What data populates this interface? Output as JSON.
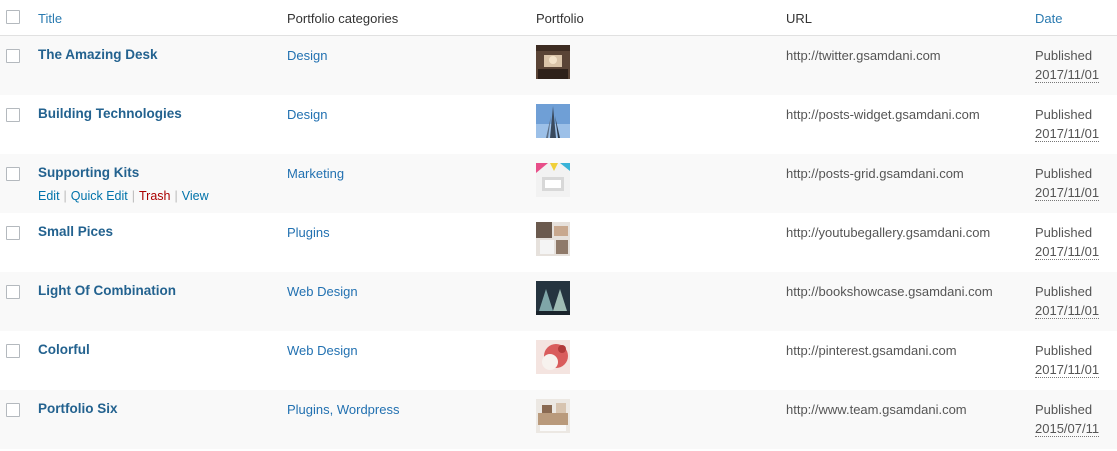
{
  "headers": {
    "title": "Title",
    "categories": "Portfolio categories",
    "portfolio": "Portfolio",
    "url": "URL",
    "date": "Date"
  },
  "row_actions": {
    "edit": "Edit",
    "quick_edit": "Quick Edit",
    "trash": "Trash",
    "view": "View",
    "separator": "|"
  },
  "rows": [
    {
      "title": "The Amazing Desk",
      "categories": "Design",
      "url": "http://twitter.gsamdani.com",
      "status": "Published",
      "date": "2017/11/01"
    },
    {
      "title": "Building Technologies",
      "categories": "Design",
      "url": "http://posts-widget.gsamdani.com",
      "status": "Published",
      "date": "2017/11/01"
    },
    {
      "title": "Supporting Kits",
      "categories": "Marketing",
      "url": "http://posts-grid.gsamdani.com",
      "status": "Published",
      "date": "2017/11/01"
    },
    {
      "title": "Small Pices",
      "categories": "Plugins",
      "url": "http://youtubegallery.gsamdani.com",
      "status": "Published",
      "date": "2017/11/01"
    },
    {
      "title": "Light Of Combination",
      "categories": "Web Design",
      "url": "http://bookshowcase.gsamdani.com",
      "status": "Published",
      "date": "2017/11/01"
    },
    {
      "title": "Colorful",
      "categories": "Web Design",
      "url": "http://pinterest.gsamdani.com",
      "status": "Published",
      "date": "2017/11/01"
    },
    {
      "title": "Portfolio Six",
      "categories": "Plugins, Wordpress",
      "url": "http://www.team.gsamdani.com",
      "status": "Published",
      "date": "2015/07/11"
    }
  ],
  "colors": {
    "link": "#2271b1",
    "title_link": "#23628f",
    "trash": "#a00000",
    "alt_row": "#f9f9f9"
  }
}
